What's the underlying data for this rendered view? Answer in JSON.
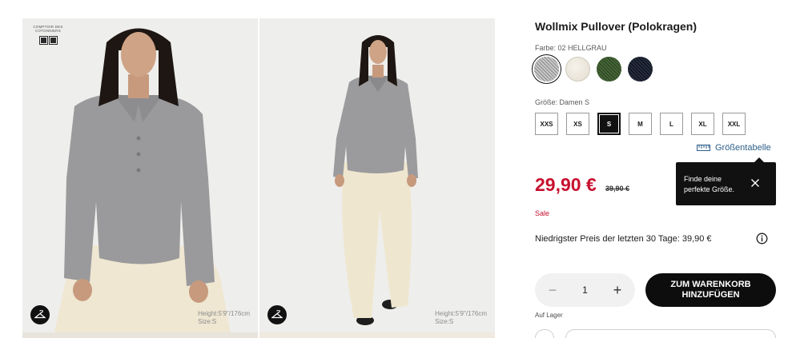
{
  "gallery": {
    "brand_logo_text": "COMPTOIR DES\nCOTONNIERS",
    "photo_1": {
      "caption_height": "Height:5'9\"/176cm",
      "caption_size": "Size:S"
    },
    "photo_2": {
      "caption_height": "Height:5'9\"/176cm",
      "caption_size": "Size:S"
    }
  },
  "product": {
    "title": "Wollmix Pullover (Polokragen)",
    "color_label": "Farbe: 02 HELLGRAU",
    "colors": [
      {
        "name": "HELLGRAU",
        "hex": "#b5b5b5",
        "selected": true
      },
      {
        "name": "OFF WHITE",
        "hex": "#efeae0",
        "selected": false
      },
      {
        "name": "OLIVE",
        "hex": "#3f5a31",
        "selected": false
      },
      {
        "name": "NAVY",
        "hex": "#1c2230",
        "selected": false
      }
    ],
    "size_label": "Größe: Damen S",
    "sizes": [
      "XXS",
      "XS",
      "S",
      "M",
      "L",
      "XL",
      "XXL"
    ],
    "selected_size": "S",
    "size_chart_link": "Größentabelle",
    "tooltip_text": "Finde deine perfekte Größe.",
    "price": "29,90 €",
    "old_price": "39,90 €",
    "sale_label": "Sale",
    "lowest_price_text": "Niedrigster Preis der letzten 30 Tage: 39,90 €",
    "quantity": "1",
    "add_to_cart_label": "ZUM WARENKORB HINZUFÜGEN",
    "stock_label": "Auf Lager"
  },
  "colors": {
    "accent_red": "#c8102e",
    "link_blue": "#2e5f8a",
    "button_black": "#0d0d0d"
  }
}
